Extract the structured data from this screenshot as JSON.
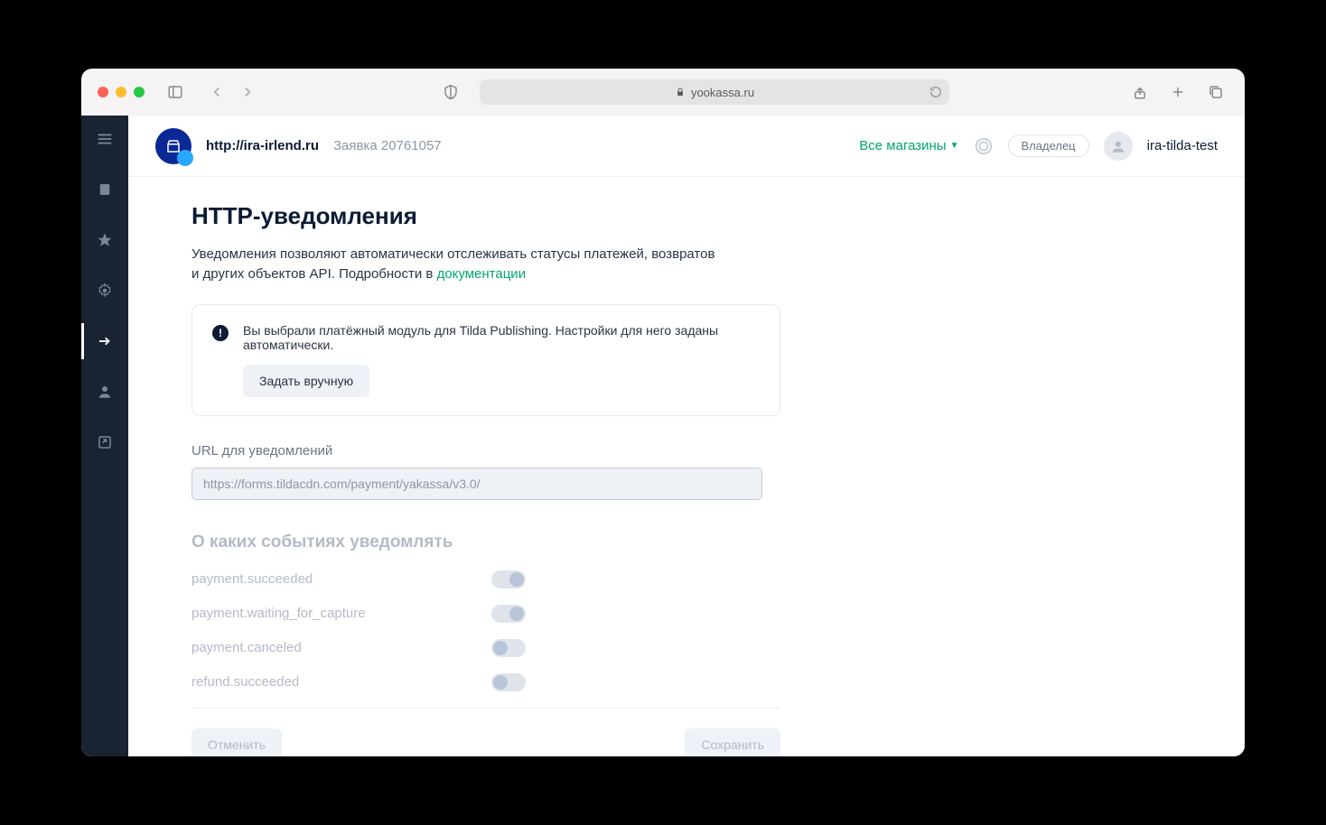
{
  "browser": {
    "url_display": "yookassa.ru"
  },
  "header": {
    "shop_url": "http://ira-irlend.ru",
    "request": "Заявка 20761057",
    "all_shops": "Все магазины",
    "owner": "Владелец",
    "username": "ira-tilda-test"
  },
  "page": {
    "title": "HTTP-уведомления",
    "description_pre": "Уведомления позволяют автоматически отслеживать статусы платежей, возвратов и других объектов API. Подробности в ",
    "description_link": "документации"
  },
  "notice": {
    "text": "Вы выбрали платёжный модуль для Tilda Publishing. Настройки для него заданы автоматически.",
    "button": "Задать вручную"
  },
  "url_field": {
    "label": "URL для уведомлений",
    "value": "https://forms.tildacdn.com/payment/yakassa/v3.0/"
  },
  "events": {
    "title": "О каких событиях уведомлять",
    "items": [
      {
        "label": "payment.succeeded",
        "on": true
      },
      {
        "label": "payment.waiting_for_capture",
        "on": true
      },
      {
        "label": "payment.canceled",
        "on": false
      },
      {
        "label": "refund.succeeded",
        "on": false
      }
    ]
  },
  "actions": {
    "cancel": "Отменить",
    "save": "Сохранить"
  }
}
